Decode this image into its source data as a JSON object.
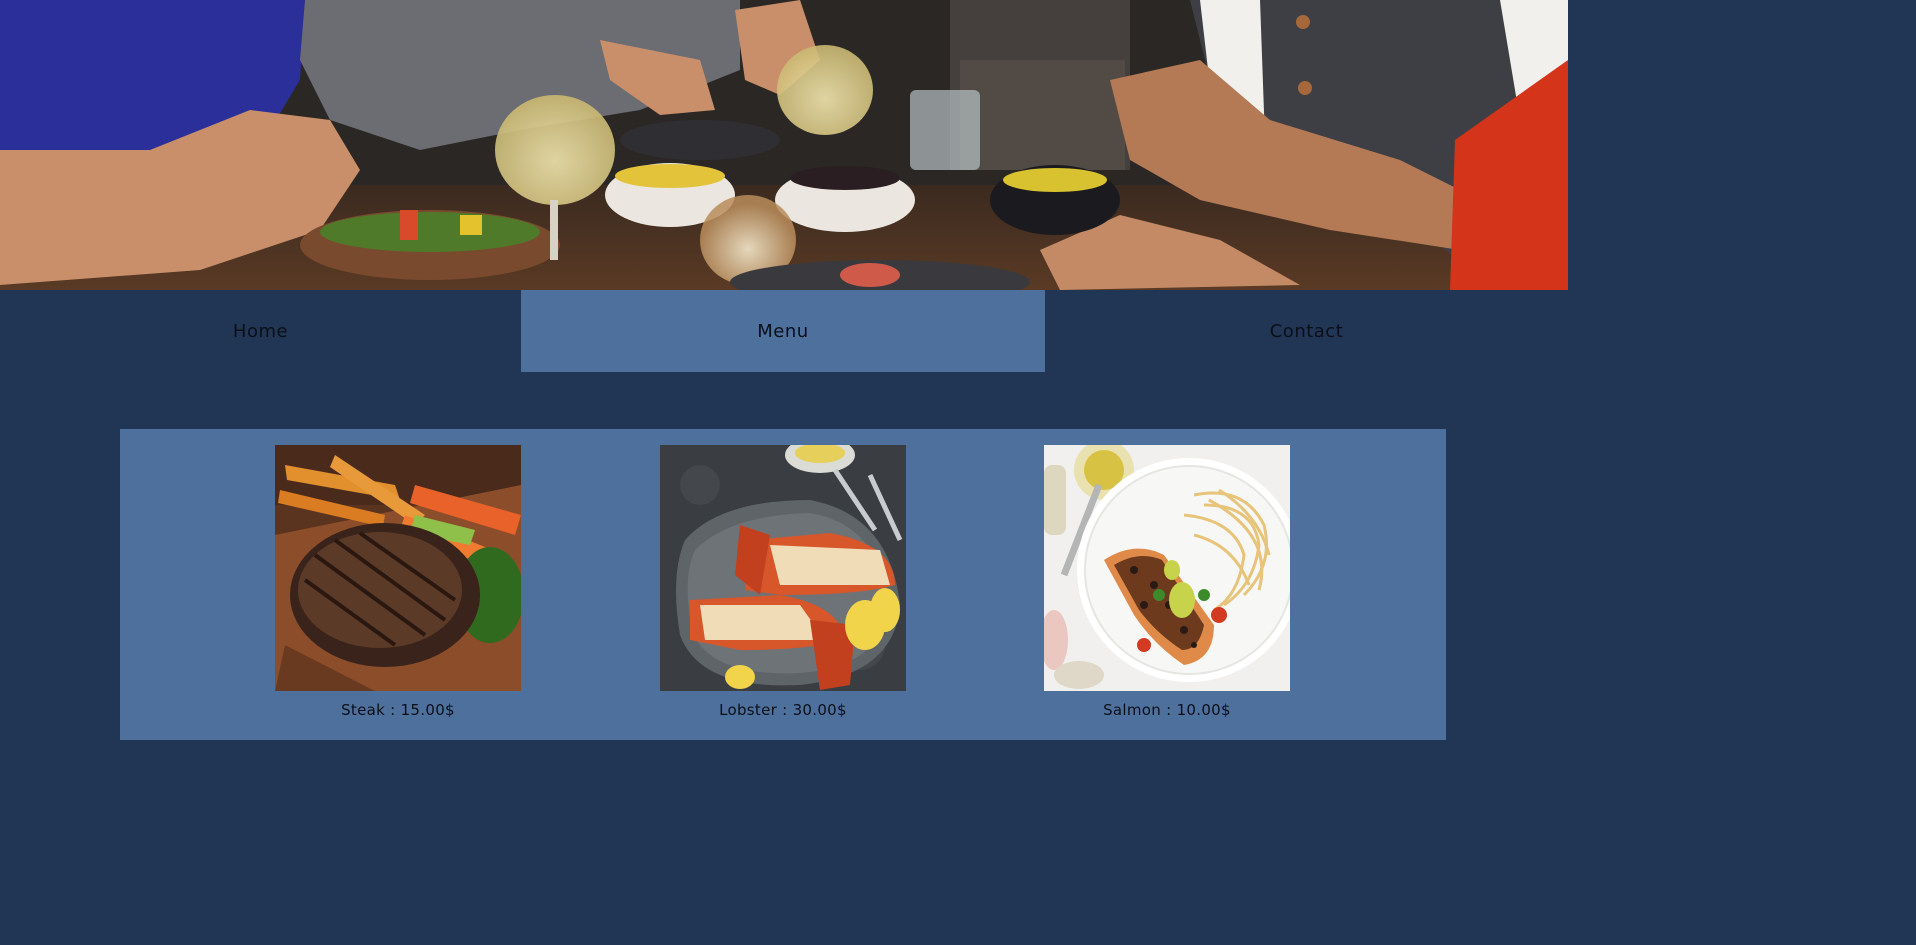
{
  "hero": {
    "image": "restaurant-dinner-photo"
  },
  "nav": {
    "items": [
      {
        "label": "Home",
        "active": false
      },
      {
        "label": "Menu",
        "active": true
      },
      {
        "label": "Contact",
        "active": false
      }
    ]
  },
  "menu": {
    "dishes": [
      {
        "image": "steak-photo",
        "caption": "Steak : 15.00$"
      },
      {
        "image": "lobster-photo",
        "caption": "Lobster : 30.00$"
      },
      {
        "image": "salmon-photo",
        "caption": "Salmon : 10.00$"
      }
    ]
  },
  "colors": {
    "page_background": "#213555",
    "accent": "#4e709d",
    "text": "#0b0f18"
  }
}
